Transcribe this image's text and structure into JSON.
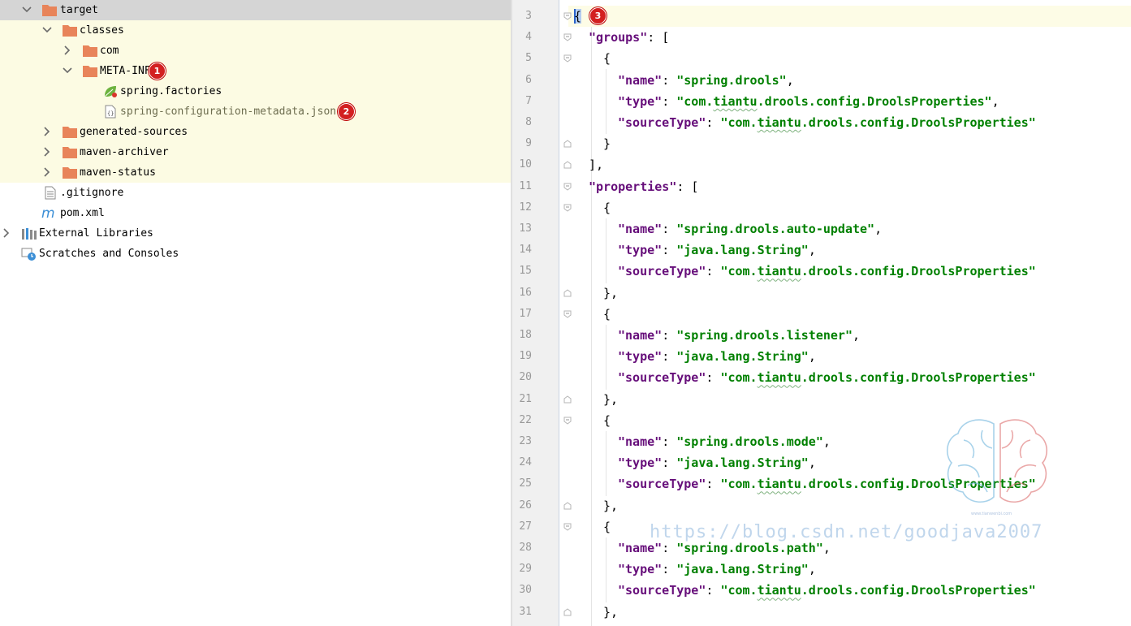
{
  "project_tree": {
    "items": [
      {
        "label": "target",
        "icon": "folder-icon",
        "expanded": true,
        "selected": true
      },
      {
        "label": "classes",
        "icon": "folder-icon",
        "expanded": true
      },
      {
        "label": "com",
        "icon": "folder-icon",
        "expanded": false
      },
      {
        "label": "META-INF",
        "icon": "folder-icon",
        "expanded": true,
        "badge": "1"
      },
      {
        "label": "spring.factories",
        "icon": "spring-leaf-icon"
      },
      {
        "label": "spring-configuration-metadata.json",
        "icon": "json-file-icon",
        "badge": "2"
      },
      {
        "label": "generated-sources",
        "icon": "folder-icon",
        "expanded": false
      },
      {
        "label": "maven-archiver",
        "icon": "folder-icon",
        "expanded": false
      },
      {
        "label": "maven-status",
        "icon": "folder-icon",
        "expanded": false
      },
      {
        "label": ".gitignore",
        "icon": "text-file-icon"
      },
      {
        "label": "pom.xml",
        "icon": "maven-icon"
      },
      {
        "label": "External Libraries",
        "icon": "libraries-icon",
        "expanded": false
      },
      {
        "label": "Scratches and Consoles",
        "icon": "scratches-icon"
      }
    ]
  },
  "editor": {
    "badge": "3",
    "lines": [
      {
        "n": "3",
        "text": "{"
      },
      {
        "n": "4",
        "text": "\"groups\": ["
      },
      {
        "n": "5",
        "text": "{"
      },
      {
        "n": "6",
        "text": "\"name\": \"spring.drools\","
      },
      {
        "n": "7",
        "text": "\"type\": \"com.tiantu.drools.config.DroolsProperties\","
      },
      {
        "n": "8",
        "text": "\"sourceType\": \"com.tiantu.drools.config.DroolsProperties\""
      },
      {
        "n": "9",
        "text": "}"
      },
      {
        "n": "10",
        "text": "],"
      },
      {
        "n": "11",
        "text": "\"properties\": ["
      },
      {
        "n": "12",
        "text": "{"
      },
      {
        "n": "13",
        "text": "\"name\": \"spring.drools.auto-update\","
      },
      {
        "n": "14",
        "text": "\"type\": \"java.lang.String\","
      },
      {
        "n": "15",
        "text": "\"sourceType\": \"com.tiantu.drools.config.DroolsProperties\""
      },
      {
        "n": "16",
        "text": "},"
      },
      {
        "n": "17",
        "text": "{"
      },
      {
        "n": "18",
        "text": "\"name\": \"spring.drools.listener\","
      },
      {
        "n": "19",
        "text": "\"type\": \"java.lang.String\","
      },
      {
        "n": "20",
        "text": "\"sourceType\": \"com.tiantu.drools.config.DroolsProperties\""
      },
      {
        "n": "21",
        "text": "},"
      },
      {
        "n": "22",
        "text": "{"
      },
      {
        "n": "23",
        "text": "\"name\": \"spring.drools.mode\","
      },
      {
        "n": "24",
        "text": "\"type\": \"java.lang.String\","
      },
      {
        "n": "25",
        "text": "\"sourceType\": \"com.tiantu.drools.config.DroolsProperties\""
      },
      {
        "n": "26",
        "text": "},"
      },
      {
        "n": "27",
        "text": "{"
      },
      {
        "n": "28",
        "text": "\"name\": \"spring.drools.path\","
      },
      {
        "n": "29",
        "text": "\"type\": \"java.lang.String\","
      },
      {
        "n": "30",
        "text": "\"sourceType\": \"com.tiantu.drools.config.DroolsProperties\""
      },
      {
        "n": "31",
        "text": "},"
      }
    ]
  },
  "watermark": {
    "url": "https://blog.csdn.net/goodjava2007",
    "small": "www.tianwenbi.com"
  },
  "colors": {
    "key": "#660e7a",
    "string": "#008000",
    "tree_highlight": "#fcfbe3",
    "selected_row": "#d5d5d5",
    "badge": "#d32020"
  }
}
